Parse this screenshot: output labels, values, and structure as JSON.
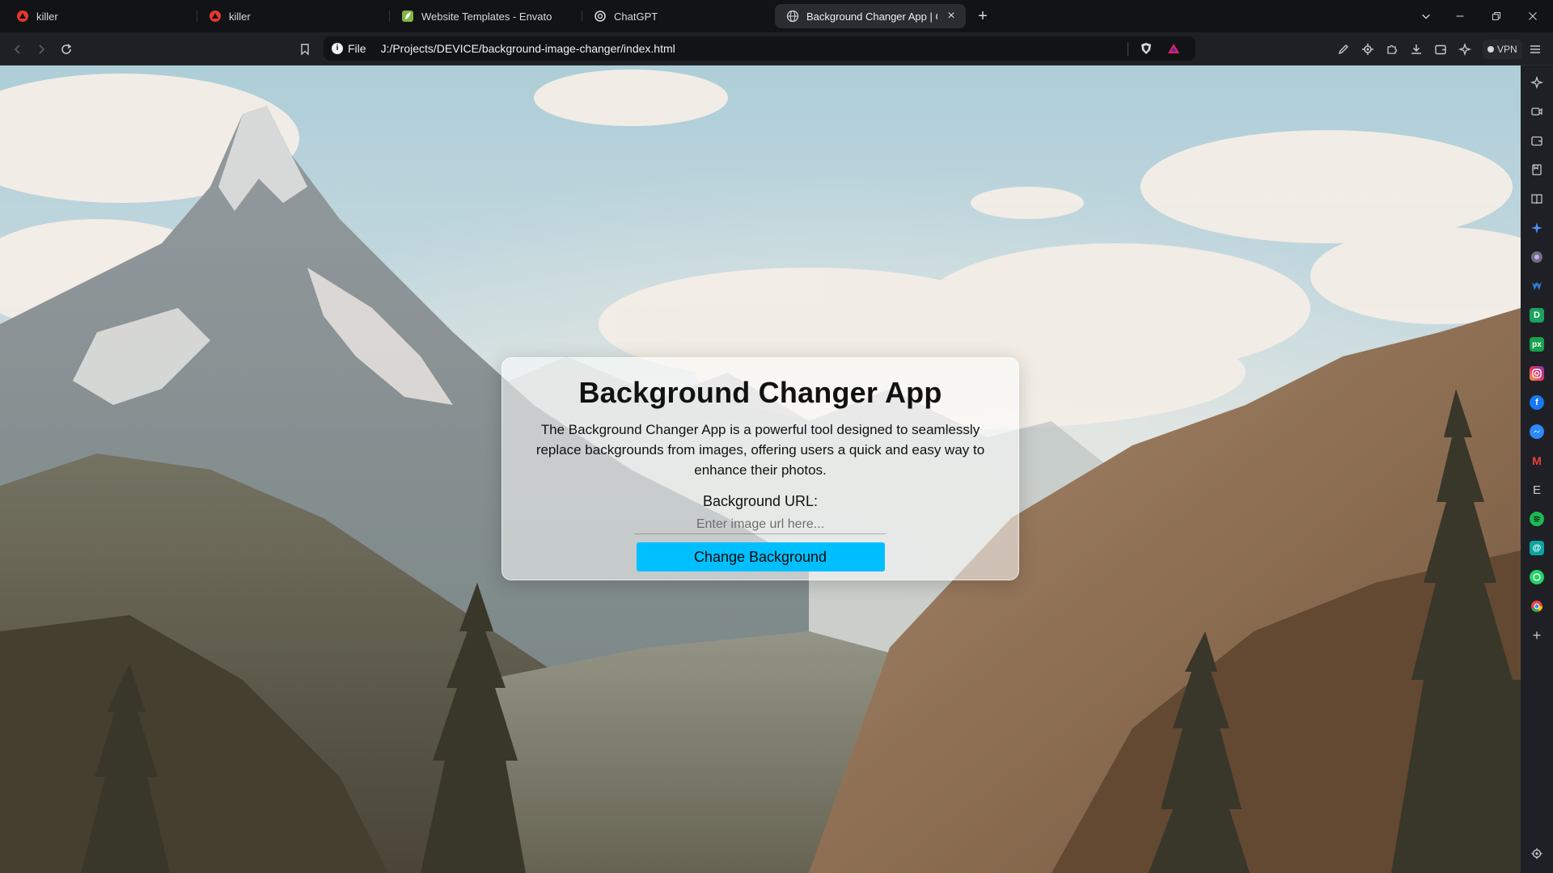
{
  "tabs": [
    {
      "title": "killer",
      "favicon": "brave-lion-icon"
    },
    {
      "title": "killer",
      "favicon": "brave-lion-icon"
    },
    {
      "title": "Website Templates - Envato",
      "favicon": "envato-leaf-icon"
    },
    {
      "title": "ChatGPT",
      "favicon": "openai-icon"
    },
    {
      "title": "Background Changer App | Code",
      "favicon": "globe-icon",
      "active": true
    }
  ],
  "new_tab_symbol": "+",
  "window_controls": {
    "tab_search": "⌄",
    "minimize": "—",
    "restore": "❐",
    "close": "✕"
  },
  "address_bar": {
    "scheme_label": "File",
    "url": "J:/Projects/DEVICE/background-image-changer/index.html"
  },
  "vpn_label": "VPN",
  "app": {
    "title": "Background Changer App",
    "description": "The Background Changer App is a powerful tool designed to seamlessly replace backgrounds from images, offering users a quick and easy way to enhance their photos.",
    "url_label": "Background URL:",
    "url_placeholder": "Enter image url here...",
    "url_value": "",
    "button_label": "Change Background"
  },
  "sidebar": {
    "items": [
      {
        "name": "leo-ai-icon"
      },
      {
        "name": "brave-talk-icon"
      },
      {
        "name": "wallet-icon"
      },
      {
        "name": "bookmarks-icon"
      },
      {
        "name": "reading-list-icon"
      },
      {
        "name": "sparkle-icon"
      },
      {
        "name": "brave-news-icon"
      },
      {
        "name": "malwarebytes-icon"
      },
      {
        "name": "green-app-icon"
      },
      {
        "name": "pixabay-icon",
        "text": "px"
      },
      {
        "name": "instagram-icon"
      },
      {
        "name": "facebook-icon",
        "text": "f"
      },
      {
        "name": "messenger-icon"
      },
      {
        "name": "gmail-icon",
        "text": "M"
      },
      {
        "name": "envato-e-icon",
        "text": "E"
      },
      {
        "name": "spotify-icon"
      },
      {
        "name": "threads-icon",
        "text": "@"
      },
      {
        "name": "whatsapp-icon"
      },
      {
        "name": "chrome-icon"
      },
      {
        "name": "add-panel-icon",
        "text": "+"
      }
    ],
    "settings": "settings-icon"
  },
  "colors": {
    "button_bg": "#00bfff",
    "tab_strip": "#121317",
    "toolbar": "#1f2025"
  }
}
